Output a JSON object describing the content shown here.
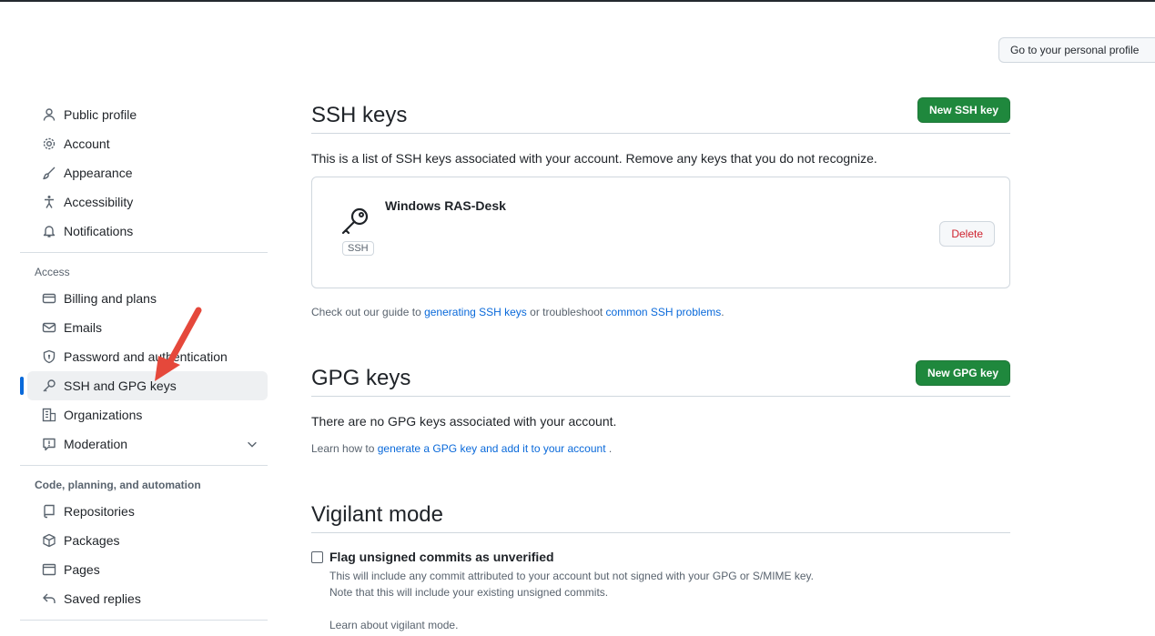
{
  "header": {
    "profile_button": "Go to your personal profile"
  },
  "sidebar": {
    "top_items": [
      {
        "label": "Public profile",
        "icon": "person-icon"
      },
      {
        "label": "Account",
        "icon": "gear-icon"
      },
      {
        "label": "Appearance",
        "icon": "paintbrush-icon"
      },
      {
        "label": "Accessibility",
        "icon": "accessibility-icon"
      },
      {
        "label": "Notifications",
        "icon": "bell-icon"
      }
    ],
    "access_title": "Access",
    "access_items": [
      {
        "label": "Billing and plans",
        "icon": "credit-card-icon"
      },
      {
        "label": "Emails",
        "icon": "mail-icon"
      },
      {
        "label": "Password and authentication",
        "icon": "shield-lock-icon"
      },
      {
        "label": "SSH and GPG keys",
        "icon": "key-icon",
        "active": true
      },
      {
        "label": "Organizations",
        "icon": "organization-icon"
      },
      {
        "label": "Moderation",
        "icon": "report-icon"
      }
    ],
    "code_title": "Code, planning, and automation",
    "code_items": [
      {
        "label": "Repositories",
        "icon": "repo-icon"
      },
      {
        "label": "Packages",
        "icon": "package-icon"
      },
      {
        "label": "Pages",
        "icon": "browser-icon"
      },
      {
        "label": "Saved replies",
        "icon": "reply-icon"
      }
    ]
  },
  "ssh": {
    "title": "SSH keys",
    "new_button": "New SSH key",
    "description": "This is a list of SSH keys associated with your account. Remove any keys that you do not recognize.",
    "key": {
      "name": "Windows RAS-Desk",
      "badge": "SSH",
      "delete_label": "Delete"
    },
    "guide_prefix": "Check out our guide to ",
    "guide_link1": "generating SSH keys",
    "guide_middle": " or troubleshoot ",
    "guide_link2": "common SSH problems",
    "guide_suffix": "."
  },
  "gpg": {
    "title": "GPG keys",
    "new_button": "New GPG key",
    "description": "There are no GPG keys associated with your account.",
    "learn_prefix": "Learn how to ",
    "learn_link": "generate a GPG key and add it to your account",
    "learn_suffix": " ."
  },
  "vigilant": {
    "title": "Vigilant mode",
    "checkbox_label": "Flag unsigned commits as unverified",
    "checked": false,
    "note1": "This will include any commit attributed to your account but not signed with your GPG or S/MIME key.",
    "note2": "Note that this will include your existing unsigned commits.",
    "learn_link": "Learn about vigilant mode."
  },
  "colors": {
    "accent": "#0969da",
    "green": "#1f883d",
    "danger": "#cf222e",
    "annotation_arrow": "#e5483b"
  }
}
